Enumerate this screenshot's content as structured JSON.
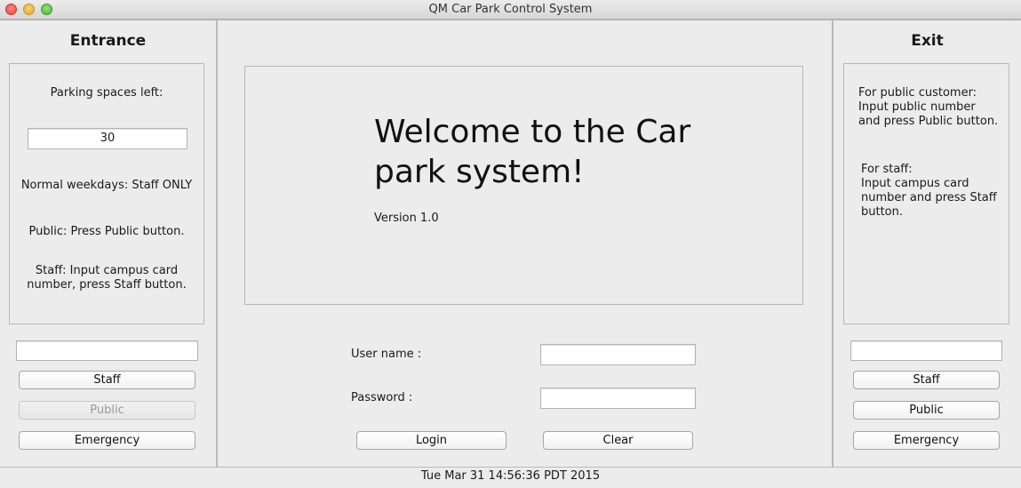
{
  "window": {
    "title": "QM Car Park Control System"
  },
  "entrance": {
    "title": "Entrance",
    "spaces_label": "Parking spaces left:",
    "spaces_value": "30",
    "info_weekdays": "Normal weekdays: Staff ONLY",
    "info_public": "Public: Press Public button.",
    "info_staff_line1": "Staff: Input campus card",
    "info_staff_line2": "number, press Staff button.",
    "input_value": "",
    "staff_label": "Staff",
    "public_label": "Public",
    "public_enabled": false,
    "emergency_label": "Emergency"
  },
  "center": {
    "welcome_line1": "Welcome to the Car",
    "welcome_line2": "park system!",
    "version": "Version 1.0",
    "username_label": "User name :",
    "username_value": "",
    "password_label": "Password :",
    "password_value": "",
    "login_label": "Login",
    "clear_label": "Clear"
  },
  "exit": {
    "title": "Exit",
    "public_line1": "For public customer:",
    "public_line2": "Input public number",
    "public_line3": "and press Public button.",
    "staff_line1": "For staff:",
    "staff_line2": "Input campus card",
    "staff_line3": "number and press Staff",
    "staff_line4": "button.",
    "input_value": "",
    "staff_label": "Staff",
    "public_label": "Public",
    "emergency_label": "Emergency"
  },
  "status_bar": {
    "datetime": "Tue Mar 31 14:56:36 PDT 2015"
  }
}
